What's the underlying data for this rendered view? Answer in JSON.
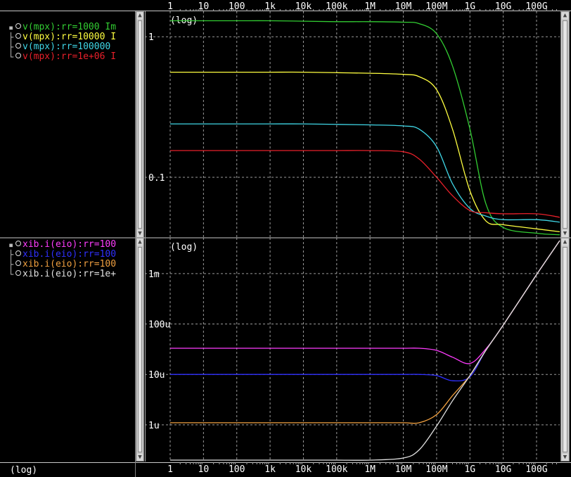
{
  "x_axis": {
    "scale": "log",
    "ticks": [
      "1",
      "10",
      "100",
      "1k",
      "10k",
      "100k",
      "1M",
      "10M",
      "100M",
      "1G",
      "10G",
      "100G"
    ]
  },
  "bottom_left_label": "(log)",
  "chart_data": [
    {
      "type": "line",
      "y_scale_label": "(log)",
      "xscale": "log",
      "yscale": "log",
      "x_range": [
        "1",
        "1T"
      ],
      "ylim": [
        0.038,
        1.45
      ],
      "grid": true,
      "y_ticks": [
        {
          "label": "1",
          "value": 1
        },
        {
          "label": "0.1",
          "value": 0.1
        }
      ],
      "x": [
        1,
        10,
        100,
        1000,
        10000,
        100000,
        1000000,
        10000000,
        30000000,
        100000000,
        300000000,
        1000000000,
        3000000000,
        10000000000,
        100000000000,
        1000000000000
      ],
      "series": [
        {
          "name": "v(mpx):rr=1000 Im",
          "color": "#32cd32",
          "values": [
            1.3,
            1.3,
            1.3,
            1.3,
            1.29,
            1.28,
            1.28,
            1.27,
            1.24,
            1.05,
            0.62,
            0.22,
            0.065,
            0.044,
            0.04,
            0.039
          ]
        },
        {
          "name": "v(mpx):rr=10000 I",
          "color": "#ffff40",
          "values": [
            0.56,
            0.56,
            0.56,
            0.56,
            0.56,
            0.555,
            0.55,
            0.54,
            0.52,
            0.42,
            0.22,
            0.08,
            0.049,
            0.046,
            0.043,
            0.041
          ]
        },
        {
          "name": "v(mpx):rr=100000",
          "color": "#3fd6e6",
          "values": [
            0.24,
            0.24,
            0.24,
            0.24,
            0.24,
            0.238,
            0.236,
            0.232,
            0.22,
            0.165,
            0.09,
            0.06,
            0.053,
            0.05,
            0.05,
            0.048
          ]
        },
        {
          "name": "v(mpx):rr=1e+06 I",
          "color": "#e8202a",
          "values": [
            0.155,
            0.155,
            0.155,
            0.155,
            0.155,
            0.155,
            0.155,
            0.152,
            0.135,
            0.1,
            0.074,
            0.058,
            0.056,
            0.055,
            0.055,
            0.052
          ]
        }
      ]
    },
    {
      "type": "line",
      "y_scale_label": "(log)",
      "xscale": "log",
      "yscale": "log",
      "x_range": [
        "1",
        "1T"
      ],
      "ylim": [
        2e-07,
        0.0045
      ],
      "grid": true,
      "y_ticks": [
        {
          "label": "1m",
          "value": 0.001
        },
        {
          "label": "100u",
          "value": 0.0001
        },
        {
          "label": "10u",
          "value": 1e-05
        },
        {
          "label": "1u",
          "value": 1e-06
        }
      ],
      "x": [
        1,
        10,
        100,
        1000,
        10000,
        100000,
        1000000,
        10000000,
        30000000,
        100000000,
        300000000,
        1000000000,
        3000000000,
        10000000000,
        100000000000,
        1000000000000
      ],
      "series": [
        {
          "name": "xib.i(eio):rr=100",
          "color": "#ff3cff",
          "values": [
            3.3e-05,
            3.3e-05,
            3.3e-05,
            3.3e-05,
            3.3e-05,
            3.3e-05,
            3.3e-05,
            3.3e-05,
            3.3e-05,
            3e-05,
            2.2e-05,
            1.65e-05,
            3.2e-05,
            9.5e-05,
            0.00095,
            0.0045
          ]
        },
        {
          "name": "xib.i(eio):rr=100",
          "color": "#3030ff",
          "values": [
            1e-05,
            1e-05,
            1e-05,
            1e-05,
            1e-05,
            1e-05,
            1e-05,
            1e-05,
            1e-05,
            9.5e-06,
            7.5e-06,
            9e-06,
            3e-05,
            9.5e-05,
            0.00095,
            0.0045
          ]
        },
        {
          "name": "xib.i(eio):rr=100",
          "color": "#f0a040",
          "values": [
            1.1e-06,
            1.1e-06,
            1.1e-06,
            1.1e-06,
            1.1e-06,
            1.1e-06,
            1.1e-06,
            1.1e-06,
            1.1e-06,
            1.6e-06,
            3.8e-06,
            9.5e-06,
            3e-05,
            9.5e-05,
            0.00095,
            0.0045
          ]
        },
        {
          "name": "xib.i(eio):rr=1e+",
          "color": "#e0e0e0",
          "values": [
            2e-07,
            2e-07,
            2e-07,
            2e-07,
            2e-07,
            2e-07,
            2e-07,
            2.2e-07,
            3.2e-07,
            9.5e-07,
            3e-06,
            9.5e-06,
            3e-05,
            9.5e-05,
            0.00095,
            0.0045
          ]
        }
      ]
    }
  ]
}
